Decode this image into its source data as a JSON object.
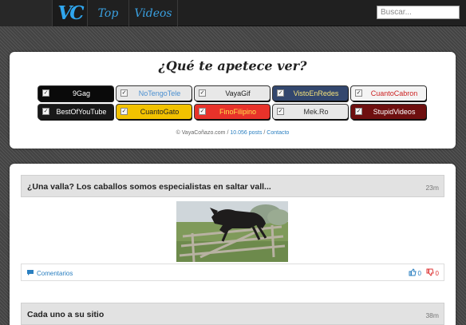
{
  "header": {
    "logo_text": "VC",
    "nav": [
      {
        "label": "Top"
      },
      {
        "label": "Videos"
      }
    ],
    "search_placeholder": "Buscar..."
  },
  "panel": {
    "title": "¿Qué te apetece ver?",
    "sites": [
      {
        "label": "9Gag",
        "bg": "#0a0a0a",
        "color": "#ffffff",
        "checked": true
      },
      {
        "label": "NoTengoTele",
        "bg": "#e8e8e8",
        "color": "#4a8fd0",
        "checked": true
      },
      {
        "label": "VayaGif",
        "bg": "#e8e8e8",
        "color": "#222222",
        "checked": true
      },
      {
        "label": "VistoEnRedes",
        "bg": "#33476e",
        "color": "#f5e27a",
        "checked": true
      },
      {
        "label": "CuantoCabron",
        "bg": "#f4f4f4",
        "color": "#cc2222",
        "checked": true
      },
      {
        "label": "BestOfYouTube",
        "bg": "#181818",
        "color": "#ffffff",
        "checked": true
      },
      {
        "label": "CuantoGato",
        "bg": "#f2c200",
        "color": "#222222",
        "checked": true
      },
      {
        "label": "FinoFilipino",
        "bg": "#e8322a",
        "color": "#ffe14a",
        "checked": true
      },
      {
        "label": "Mek.Ro",
        "bg": "#e8e8e8",
        "color": "#333333",
        "checked": true
      },
      {
        "label": "StupidVideos",
        "bg": "#6e0f0f",
        "color": "#ffffff",
        "checked": true
      }
    ],
    "footer_site": "© VayaCoñazo.com",
    "footer_sep1": " / ",
    "footer_posts": "10.056 posts",
    "footer_sep2": " / ",
    "footer_contact": "Contacto"
  },
  "posts": [
    {
      "title": "¿Una valla? Los caballos somos especialistas en saltar vall...",
      "time": "23m",
      "comments_label": "Comentarios",
      "upvotes": "0",
      "downvotes": "0"
    },
    {
      "title": "Cada uno a su sitio",
      "time": "38m"
    }
  ]
}
